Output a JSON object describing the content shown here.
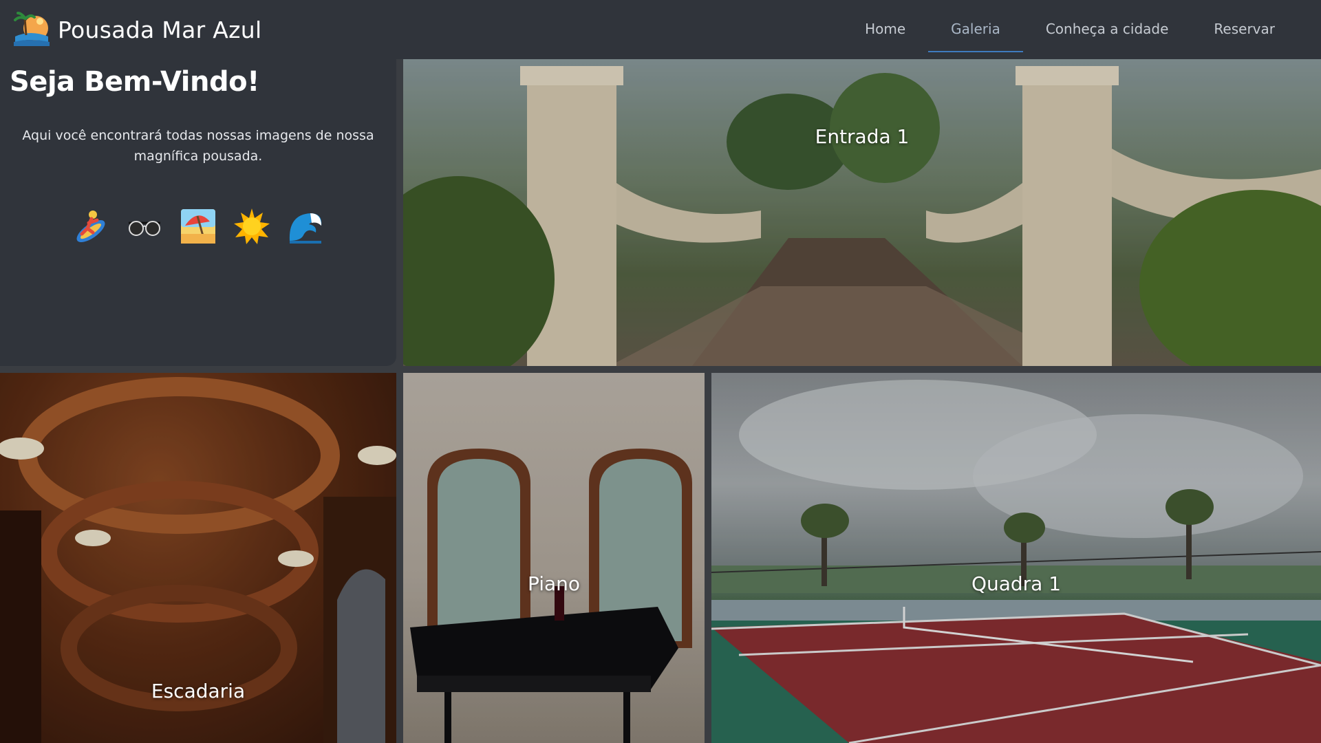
{
  "header": {
    "brand_title": "Pousada Mar Azul",
    "nav": [
      {
        "label": "Home",
        "active": false
      },
      {
        "label": "Galeria",
        "active": true
      },
      {
        "label": "Conheça a cidade",
        "active": false
      },
      {
        "label": "Reservar",
        "active": false
      }
    ]
  },
  "intro": {
    "title": "Seja Bem-Vindo!",
    "text": "Aqui você encontrará todas nossas imagens de nossa magnífica pousada.",
    "emojis": [
      "surfer-icon",
      "sunglasses-icon",
      "beach-umbrella-icon",
      "sun-icon",
      "wave-icon"
    ]
  },
  "gallery": {
    "entrada": "Entrada 1",
    "escadaria": "Escadaria",
    "piano": "Piano",
    "quadra": "Quadra 1"
  },
  "colors": {
    "background": "#3a3d42",
    "panel": "#30343b",
    "nav_active_underline": "#3e7bbf",
    "nav_text": "#c6cbd2"
  }
}
